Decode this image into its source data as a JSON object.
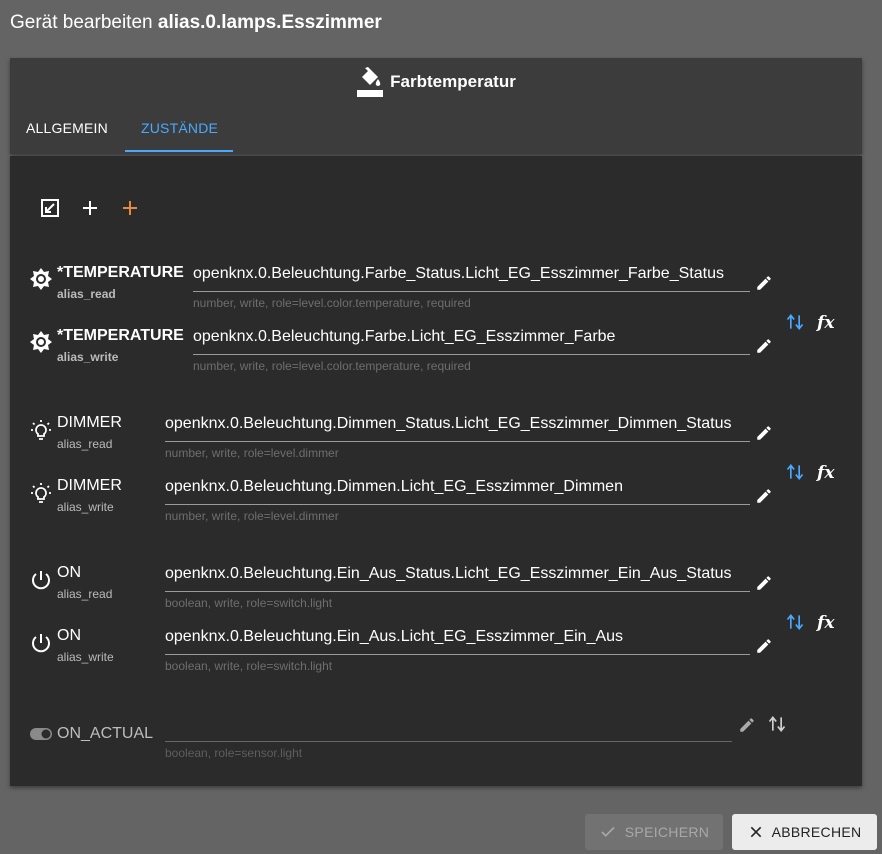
{
  "dialog": {
    "title_prefix": "Gerät bearbeiten",
    "title_id": "alias.0.lamps.Esszimmer"
  },
  "header": {
    "device_type": "Farbtemperatur",
    "device_icon": "paint-bucket-icon"
  },
  "tabs": [
    {
      "label": "ALLGEMEIN"
    },
    {
      "label": "ZUSTÄNDE",
      "active": true
    }
  ],
  "toolbar": {
    "icons": [
      "expand-icon",
      "add-icon",
      "add-custom-icon"
    ]
  },
  "states": [
    {
      "name": "*TEMPERATURE",
      "role_label": "alias_read",
      "value": "openknx.0.Beleuchtung.Farbe_Status.Licht_EG_Esszimmer_Farbe_Status",
      "help": "number, write, role=level.color.temperature, required"
    },
    {
      "name": "*TEMPERATURE",
      "role_label": "alias_write",
      "value": "openknx.0.Beleuchtung.Farbe.Licht_EG_Esszimmer_Farbe",
      "help": "number, write, role=level.color.temperature, required"
    },
    {
      "name": "DIMMER",
      "role_label": "alias_read",
      "value": "openknx.0.Beleuchtung.Dimmen_Status.Licht_EG_Esszimmer_Dimmen_Status",
      "help": "number, write, role=level.dimmer"
    },
    {
      "name": "DIMMER",
      "role_label": "alias_write",
      "value": "openknx.0.Beleuchtung.Dimmen.Licht_EG_Esszimmer_Dimmen",
      "help": "number, write, role=level.dimmer"
    },
    {
      "name": "ON",
      "role_label": "alias_read",
      "value": "openknx.0.Beleuchtung.Ein_Aus_Status.Licht_EG_Esszimmer_Ein_Aus_Status",
      "help": "boolean, write, role=switch.light"
    },
    {
      "name": "ON",
      "role_label": "alias_write",
      "value": "openknx.0.Beleuchtung.Ein_Aus.Licht_EG_Esszimmer_Ein_Aus",
      "help": "boolean, write, role=switch.light"
    },
    {
      "name": "ON_ACTUAL",
      "value": "",
      "help": "boolean, role=sensor.light"
    }
  ],
  "actions": {
    "save": "SPEICHERN",
    "cancel": "ABBRECHEN"
  },
  "colors": {
    "accent": "#4aa8ff",
    "orange": "#e88a3c"
  }
}
